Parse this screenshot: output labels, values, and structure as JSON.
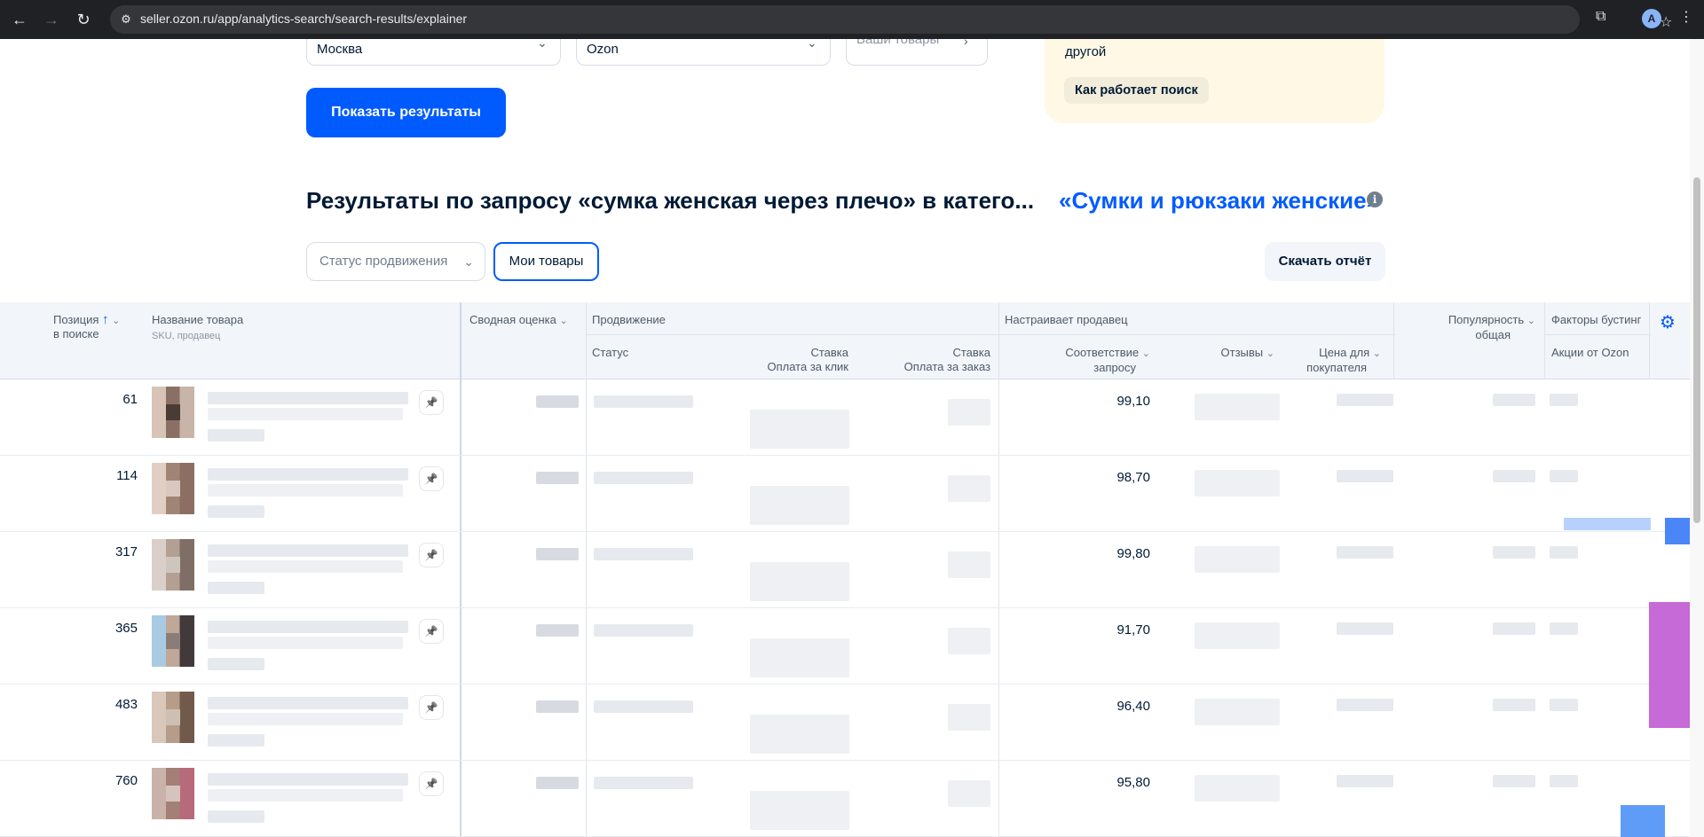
{
  "browser": {
    "url": "seller.ozon.ru/app/analytics-search/search-results/explainer",
    "profile_initial": "A"
  },
  "filters": {
    "region_value": "Москва",
    "platform_value": "Ozon",
    "products_placeholder": "Ваши товары",
    "show_button": "Показать результаты"
  },
  "info_box": {
    "text": "другой",
    "link": "Как работает поиск"
  },
  "results": {
    "title": "Результаты по запросу «сумка женская через плечо» в катего...",
    "category": "«Сумки и рюкзаки женские»",
    "status_filter": "Статус продвижения",
    "my_products": "Мои товары",
    "download": "Скачать отчёт"
  },
  "table": {
    "headers": {
      "position_l1": "Позиция",
      "position_l2": "в поиске",
      "product": "Название товара",
      "product_sub": "SKU, продавец",
      "summary": "Сводная оценка",
      "promotion": "Продвижение",
      "status": "Статус",
      "bid_click_l1": "Ставка",
      "bid_click_l2": "Оплата за клик",
      "bid_order_l1": "Ставка",
      "bid_order_l2": "Оплата за заказ",
      "seller_group": "Настраивает продавец",
      "relevance_l1": "Соответствие",
      "relevance_l2": "запросу",
      "reviews": "Отзывы",
      "price_l1": "Цена для",
      "price_l2": "покупателя",
      "popularity_l1": "Популярность",
      "popularity_l2": "общая",
      "boost_group": "Факторы бустинг",
      "ozon_promos": "Акции от Ozon"
    },
    "rows": [
      {
        "position": "61",
        "relevance": "99,10"
      },
      {
        "position": "114",
        "relevance": "98,70"
      },
      {
        "position": "317",
        "relevance": "99,80"
      },
      {
        "position": "365",
        "relevance": "91,70"
      },
      {
        "position": "483",
        "relevance": "96,40"
      },
      {
        "position": "760",
        "relevance": "95,80"
      }
    ]
  },
  "colors": {
    "primary": "#005bff",
    "info_bg": "#fff8e5",
    "header_bg": "#f2f5f9"
  }
}
